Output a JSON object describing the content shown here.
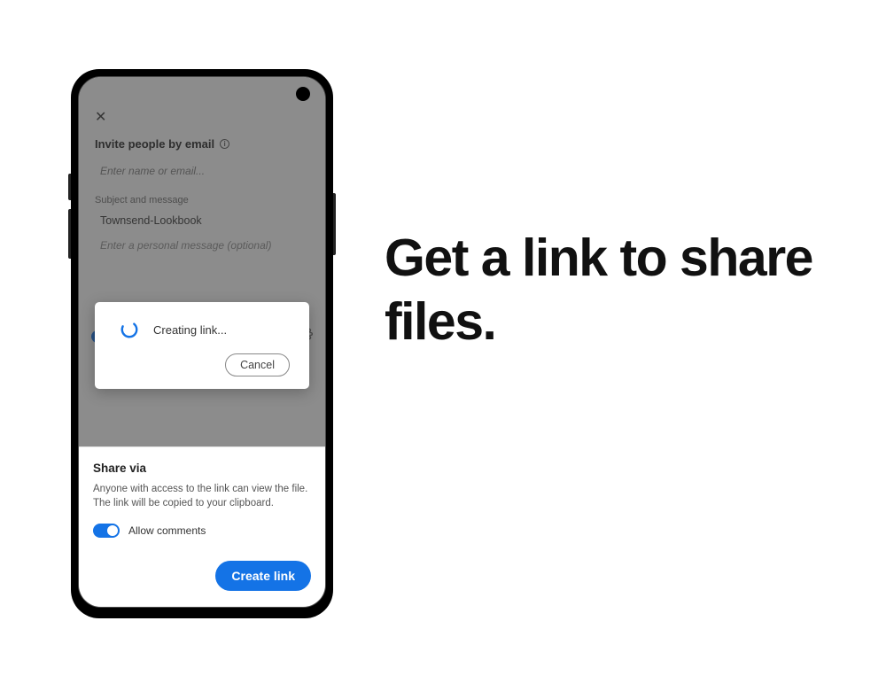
{
  "headline": "Get a link to share files.",
  "underlay": {
    "close_glyph": "✕",
    "invite_title": "Invite people by email",
    "email_placeholder": "Enter name or email...",
    "section_label": "Subject and message",
    "subject_value": "Townsend-Lookbook",
    "message_placeholder": "Enter a personal message (optional)"
  },
  "dialog": {
    "status_text": "Creating link...",
    "cancel_label": "Cancel"
  },
  "sheet": {
    "title": "Share via",
    "description": "Anyone with access to the link can view the file. The link will be copied to your clipboard.",
    "allow_comments_label": "Allow comments",
    "create_label": "Create link"
  }
}
